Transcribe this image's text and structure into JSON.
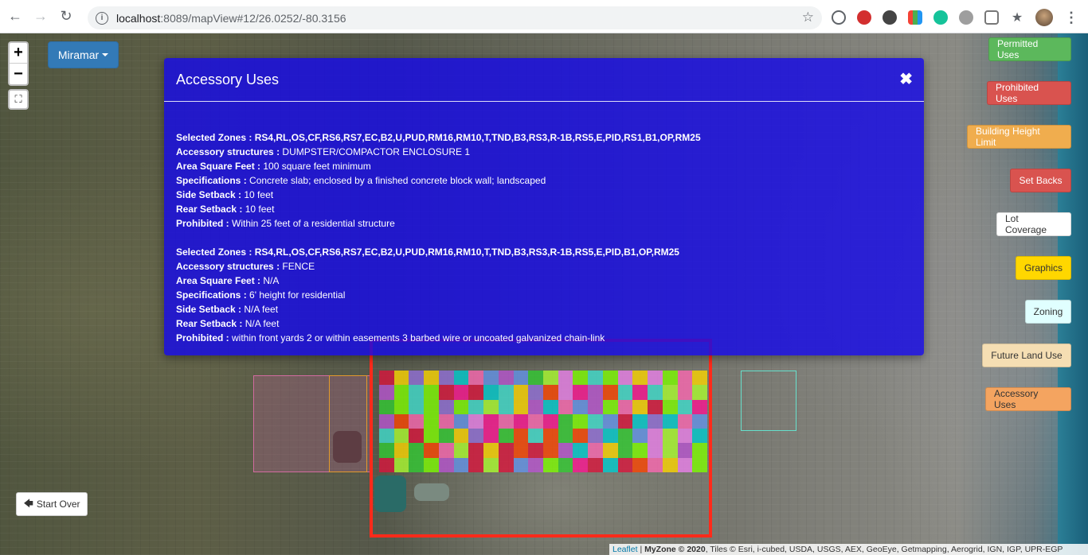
{
  "browser": {
    "url_host": "localhost",
    "url_rest": ":8089/mapView#12/26.0252/-80.3156"
  },
  "map": {
    "city_dropdown": "Miramar",
    "start_over": "Start Over",
    "zoom_in": "+",
    "zoom_out": "−"
  },
  "layers": [
    {
      "label": "Permitted Uses",
      "bg": "#5cb85c",
      "fg": "#ffffff"
    },
    {
      "label": "Prohibited Uses",
      "bg": "#d9534f",
      "fg": "#ffffff"
    },
    {
      "label": "Building Height Limit",
      "bg": "#f0ad4e",
      "fg": "#ffffff"
    },
    {
      "label": "Set Backs",
      "bg": "#d9534f",
      "fg": "#ffffff"
    },
    {
      "label": "Lot Coverage",
      "bg": "#ffffff",
      "fg": "#333333"
    },
    {
      "label": "Graphics",
      "bg": "#ffd700",
      "fg": "#333333"
    },
    {
      "label": "Zoning",
      "bg": "#e0ffff",
      "fg": "#333333"
    },
    {
      "label": "Future Land Use",
      "bg": "#f5deb3",
      "fg": "#333333"
    },
    {
      "label": "Accessory Uses",
      "bg": "#f4a460",
      "fg": "#333333"
    }
  ],
  "modal": {
    "title": "Accessory Uses",
    "close": "✖",
    "entries": [
      {
        "zones_label": "Selected Zones : ",
        "zones": "RS4,RL,OS,CF,RS6,RS7,EC,B2,U,PUD,RM16,RM10,T,TND,B3,RS3,R-1B,RS5,E,PID,RS1,B1,OP,RM25",
        "structures_label": "Accessory structures : ",
        "structures": "DUMPSTER/COMPACTOR ENCLOSURE 1",
        "area_label": "Area Square Feet : ",
        "area": "100 square feet minimum",
        "spec_label": "Specifications : ",
        "spec": "Concrete slab; enclosed by a finished concrete block wall; landscaped",
        "side_label": "Side Setback : ",
        "side": "10 feet",
        "rear_label": "Rear Setback : ",
        "rear": "10 feet",
        "prohibited_label": "Prohibited : ",
        "prohibited": "Within 25 feet of a residential structure"
      },
      {
        "zones_label": "Selected Zones : ",
        "zones": "RS4,RL,OS,CF,RS6,RS7,EC,B2,U,PUD,RM16,RM10,T,TND,B3,RS3,R-1B,RS5,E,PID,B1,OP,RM25",
        "structures_label": "Accessory structures : ",
        "structures": "FENCE",
        "area_label": "Area Square Feet : ",
        "area": "N/A",
        "spec_label": "Specifications : ",
        "spec": "6' height for residential",
        "side_label": "Side Setback : ",
        "side": "N/A feet",
        "rear_label": "Rear Setback : ",
        "rear": "N/A feet",
        "prohibited_label": "Prohibited : ",
        "prohibited": "within front yards 2 or within easements 3 barbed wire or uncoated galvanized chain-link"
      }
    ]
  },
  "attribution": {
    "leaflet": "Leaflet",
    "sep": " | ",
    "myzone": "MyZone © 2020",
    "tiles": ", Tiles © Esri, i-cubed, USDA, USGS, AEX, GeoEye, Getmapping, Aerogrid, IGN, IGP, UPR-EGP"
  }
}
